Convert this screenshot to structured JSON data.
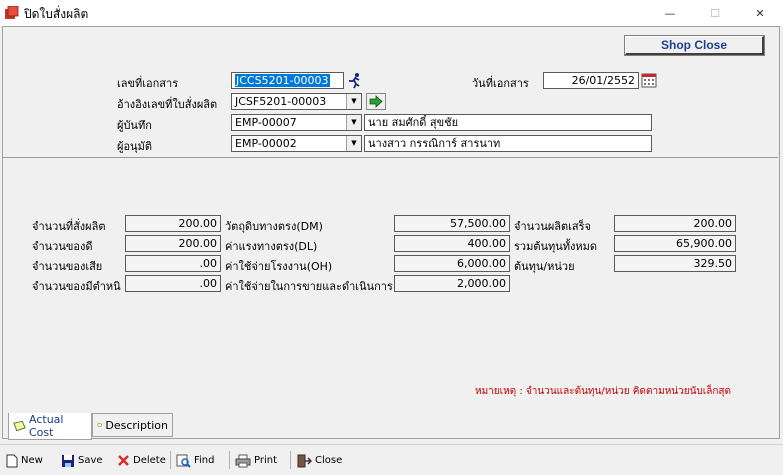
{
  "window": {
    "title": "ปิดใบสั่งผลิต",
    "minimize": "—",
    "maximize": "☐",
    "close": "✕"
  },
  "header": {
    "shop_close_label": "Shop Close",
    "doc_no_label": "เลขที่เอกสาร",
    "doc_no_value": "JCCS5201-00003",
    "doc_date_label": "วันที่เอกสาร",
    "doc_date_value": "26/01/2552",
    "ref_order_label": "อ้างอิงเลขที่ใบสั่งผลิต",
    "ref_order_value": "JCSF5201-00003",
    "recorder_label": "ผู้บันทึก",
    "recorder_code": "EMP-00007",
    "recorder_name": "นาย สมศักดิ์  สุขชัย",
    "approver_label": "ผู้อนุมัติ",
    "approver_code": "EMP-00002",
    "approver_name": "นางสาว กรรณิการ์ สารนาท"
  },
  "summary": {
    "order_qty_label": "จำนวนที่สั่งผลิต",
    "order_qty": "200.00",
    "good_qty_label": "จำนวนของดี",
    "good_qty": "200.00",
    "defect_qty_label": "จำนวนของเสีย",
    "defect_qty": ".00",
    "flawed_qty_label": "จำนวนของมีตำหนิ",
    "flawed_qty": ".00",
    "dm_label": "วัตถุดิบทางตรง(DM)",
    "dm_value": "57,500.00",
    "dl_label": "ค่าแรงทางตรง(DL)",
    "dl_value": "400.00",
    "oh_label": "ค่าใช้จ่ายโรงงาน(OH)",
    "oh_value": "6,000.00",
    "selling_label": "ค่าใช้จ่ายในการขายและดำเนินการ",
    "selling_value": "2,000.00",
    "finished_qty_label": "จำนวนผลิตเสร็จ",
    "finished_qty": "200.00",
    "total_cost_label": "รวมต้นทุนทั้งหมด",
    "total_cost": "65,900.00",
    "unit_cost_label": "ต้นทุน/หน่วย",
    "unit_cost": "329.50",
    "remark": "หมายเหตุ : จำนวนและต้นทุน/หน่วย คิดตามหน่วยนับเล็กสุด"
  },
  "tabs": [
    {
      "label": "Actual Cost"
    },
    {
      "label": "Description"
    }
  ],
  "toolbar": {
    "new": "New",
    "save": "Save",
    "delete": "Delete",
    "find": "Find",
    "print": "Print",
    "close": "Close"
  },
  "colors": {
    "accent": "#0078d7",
    "shop_close_text": "#1f3f8f",
    "remark": "#c00000"
  }
}
